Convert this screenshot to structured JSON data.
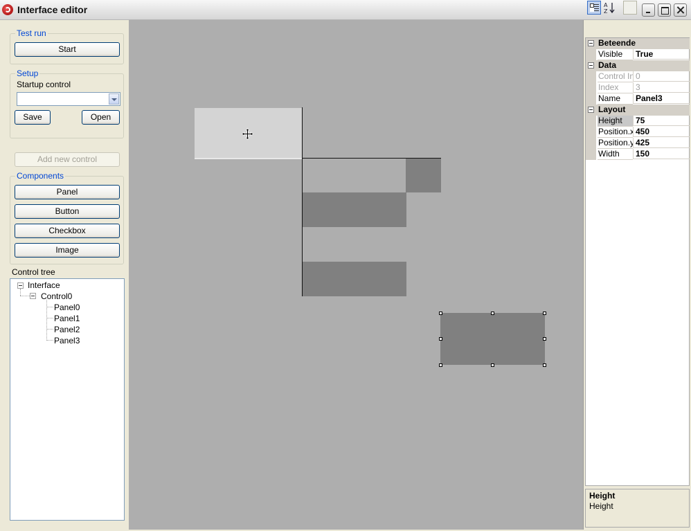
{
  "window": {
    "title": "Interface editor",
    "icon": "app-logo-icon"
  },
  "test_run": {
    "title": "Test run",
    "start_label": "Start"
  },
  "setup": {
    "title": "Setup",
    "startup_control_label": "Startup control",
    "startup_control_value": "",
    "save_label": "Save",
    "open_label": "Open"
  },
  "add_new_control_label": "Add new control",
  "components": {
    "title": "Components",
    "items": [
      "Panel",
      "Button",
      "Checkbox",
      "Image"
    ]
  },
  "control_tree": {
    "label": "Control tree",
    "root": "Interface",
    "child": "Control0",
    "leaves": [
      "Panel0",
      "Panel1",
      "Panel2",
      "Panel3"
    ]
  },
  "properties": {
    "categories": [
      {
        "name": "Beteende",
        "rows": [
          {
            "name": "Visible",
            "value": "True"
          }
        ]
      },
      {
        "name": "Data",
        "rows": [
          {
            "name": "Control Ind",
            "value": "0"
          },
          {
            "name": "Index",
            "value": "3"
          },
          {
            "name": "Name",
            "value": "Panel3"
          }
        ]
      },
      {
        "name": "Layout",
        "rows": [
          {
            "name": "Height",
            "value": "75"
          },
          {
            "name": "Position.x",
            "value": "450"
          },
          {
            "name": "Position.y",
            "value": "425"
          },
          {
            "name": "Width",
            "value": "150"
          }
        ]
      }
    ],
    "help_title": "Height",
    "help_description": "Height"
  },
  "colors": {
    "canvas": "#aeaeae",
    "panel": "#808080",
    "selection": "#d4d4d4",
    "group_title": "#0046d5"
  }
}
